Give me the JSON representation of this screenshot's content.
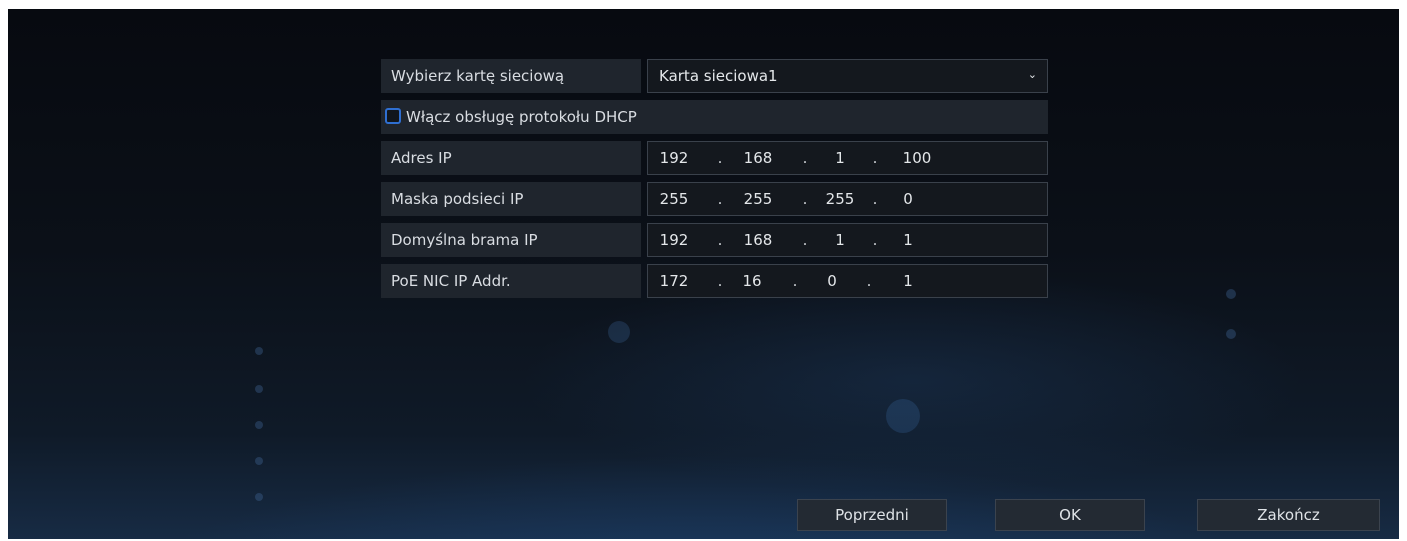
{
  "network_card": {
    "label": "Wybierz kartę sieciową",
    "value": "Karta sieciowa1",
    "icon": "chevron-down-icon"
  },
  "dhcp": {
    "label": "Włącz obsługę protokołu DHCP",
    "checked": false
  },
  "fields": [
    {
      "label": "Adres IP",
      "octets": [
        "192",
        "168",
        "1",
        "100"
      ]
    },
    {
      "label": "Maska podsieci IP",
      "octets": [
        "255",
        "255",
        "255",
        "0"
      ]
    },
    {
      "label": "Domyślna brama IP",
      "octets": [
        "192",
        "168",
        "1",
        "1"
      ]
    },
    {
      "label": "PoE NIC IP Addr.",
      "octets": [
        "172",
        "16",
        "0",
        "1"
      ]
    }
  ],
  "ip_separator": ".",
  "buttons": {
    "previous": "Poprzedni",
    "ok": "OK",
    "finish": "Zakończ"
  },
  "colors": {
    "checkbox_border": "#2f6fd1",
    "label_bg": "#1f252d",
    "input_bg": "#14181e"
  }
}
